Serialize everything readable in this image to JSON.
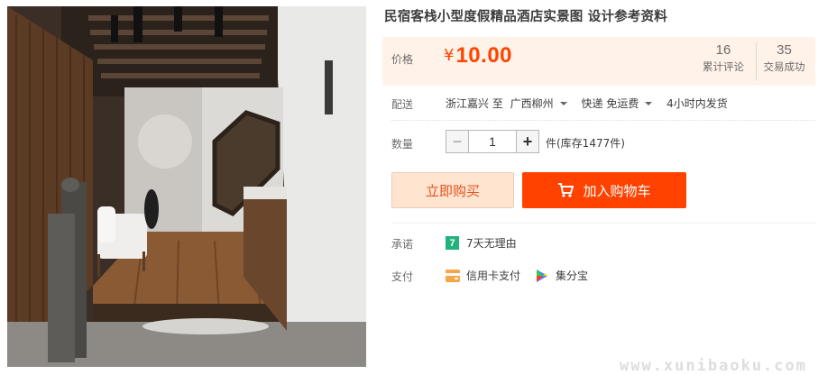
{
  "product": {
    "image_alt": "hotel corridor interior photo",
    "title": "民宿客栈小型度假精品酒店实景图 设计参考资料"
  },
  "price": {
    "label": "价格",
    "currency": "¥",
    "amount": "10.00",
    "color": "#ff4400"
  },
  "stats": [
    {
      "num": "16",
      "label": "累计评论"
    },
    {
      "num": "35",
      "label": "交易成功"
    }
  ],
  "shipping": {
    "label": "配送",
    "from": "浙江嘉兴 至",
    "to": "广西柳州",
    "method": "快递 免运费",
    "dispatch": "4小时内发货"
  },
  "quantity": {
    "label": "数量",
    "value": "1",
    "minus": "−",
    "plus": "+",
    "stock": "件(库存1477件)"
  },
  "actions": {
    "buy_now": "立即购买",
    "add_cart": "加入购物车",
    "cart_color": "#ff4200"
  },
  "promise": {
    "label": "承诺",
    "badge": "7",
    "text": "7天无理由"
  },
  "payment": {
    "label": "支付",
    "credit": "信用卡支付",
    "jifenbao": "集分宝"
  },
  "watermark": "www.xunibaoku.com"
}
